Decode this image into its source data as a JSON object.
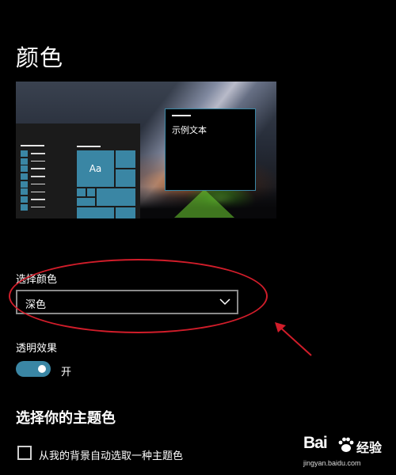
{
  "page": {
    "title": "颜色"
  },
  "preview": {
    "sample_text": "示例文本",
    "tile_label": "Aa"
  },
  "choose_color": {
    "label": "选择颜色",
    "selected": "深色"
  },
  "transparency": {
    "label": "透明效果",
    "state_text": "开",
    "on": true
  },
  "accent": {
    "title": "选择你的主题色",
    "auto_pick_label": "从我的背景自动选取一种主题色",
    "auto_pick_checked": false
  },
  "watermark": {
    "brand": "Bai",
    "brand_suffix": "经验",
    "url": "jingyan.baidu.com"
  },
  "colors": {
    "accent": "#3a86a4",
    "annotation": "#d11d2a",
    "background": "#000000"
  }
}
